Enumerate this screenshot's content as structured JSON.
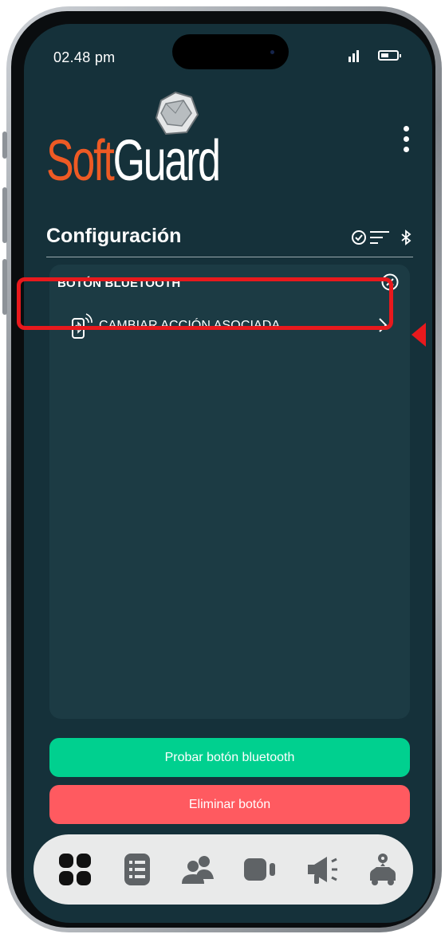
{
  "status_bar": {
    "time": "02.48 pm"
  },
  "brand": {
    "part1": "Soft",
    "part2": "Guard",
    "orange": "#ee5a24"
  },
  "header": {
    "title": "Configuración",
    "icons": [
      "check-circle-icon",
      "filter-lines-icon",
      "bluetooth-icon"
    ]
  },
  "panel": {
    "title": "BOTÓN BLUETOOTH",
    "close_icon": "close-circle-icon",
    "items": [
      {
        "label": "CAMBIAR ACCIÓN ASOCIADA",
        "icon": "bluetooth-phone-icon",
        "trailing_icon": "chevron-right-icon"
      }
    ]
  },
  "buttons": {
    "test_label": "Probar botón bluetooth",
    "delete_label": "Eliminar botón"
  },
  "colors": {
    "background": "#15313a",
    "panel": "#1c3b44",
    "green": "#00d08f",
    "red": "#ff5a60",
    "highlight": "#e8191d"
  },
  "bottom_nav": {
    "items": [
      "dashboard-grid-icon",
      "list-icon",
      "users-icon",
      "video-camera-icon",
      "megaphone-icon",
      "location-car-icon"
    ]
  }
}
